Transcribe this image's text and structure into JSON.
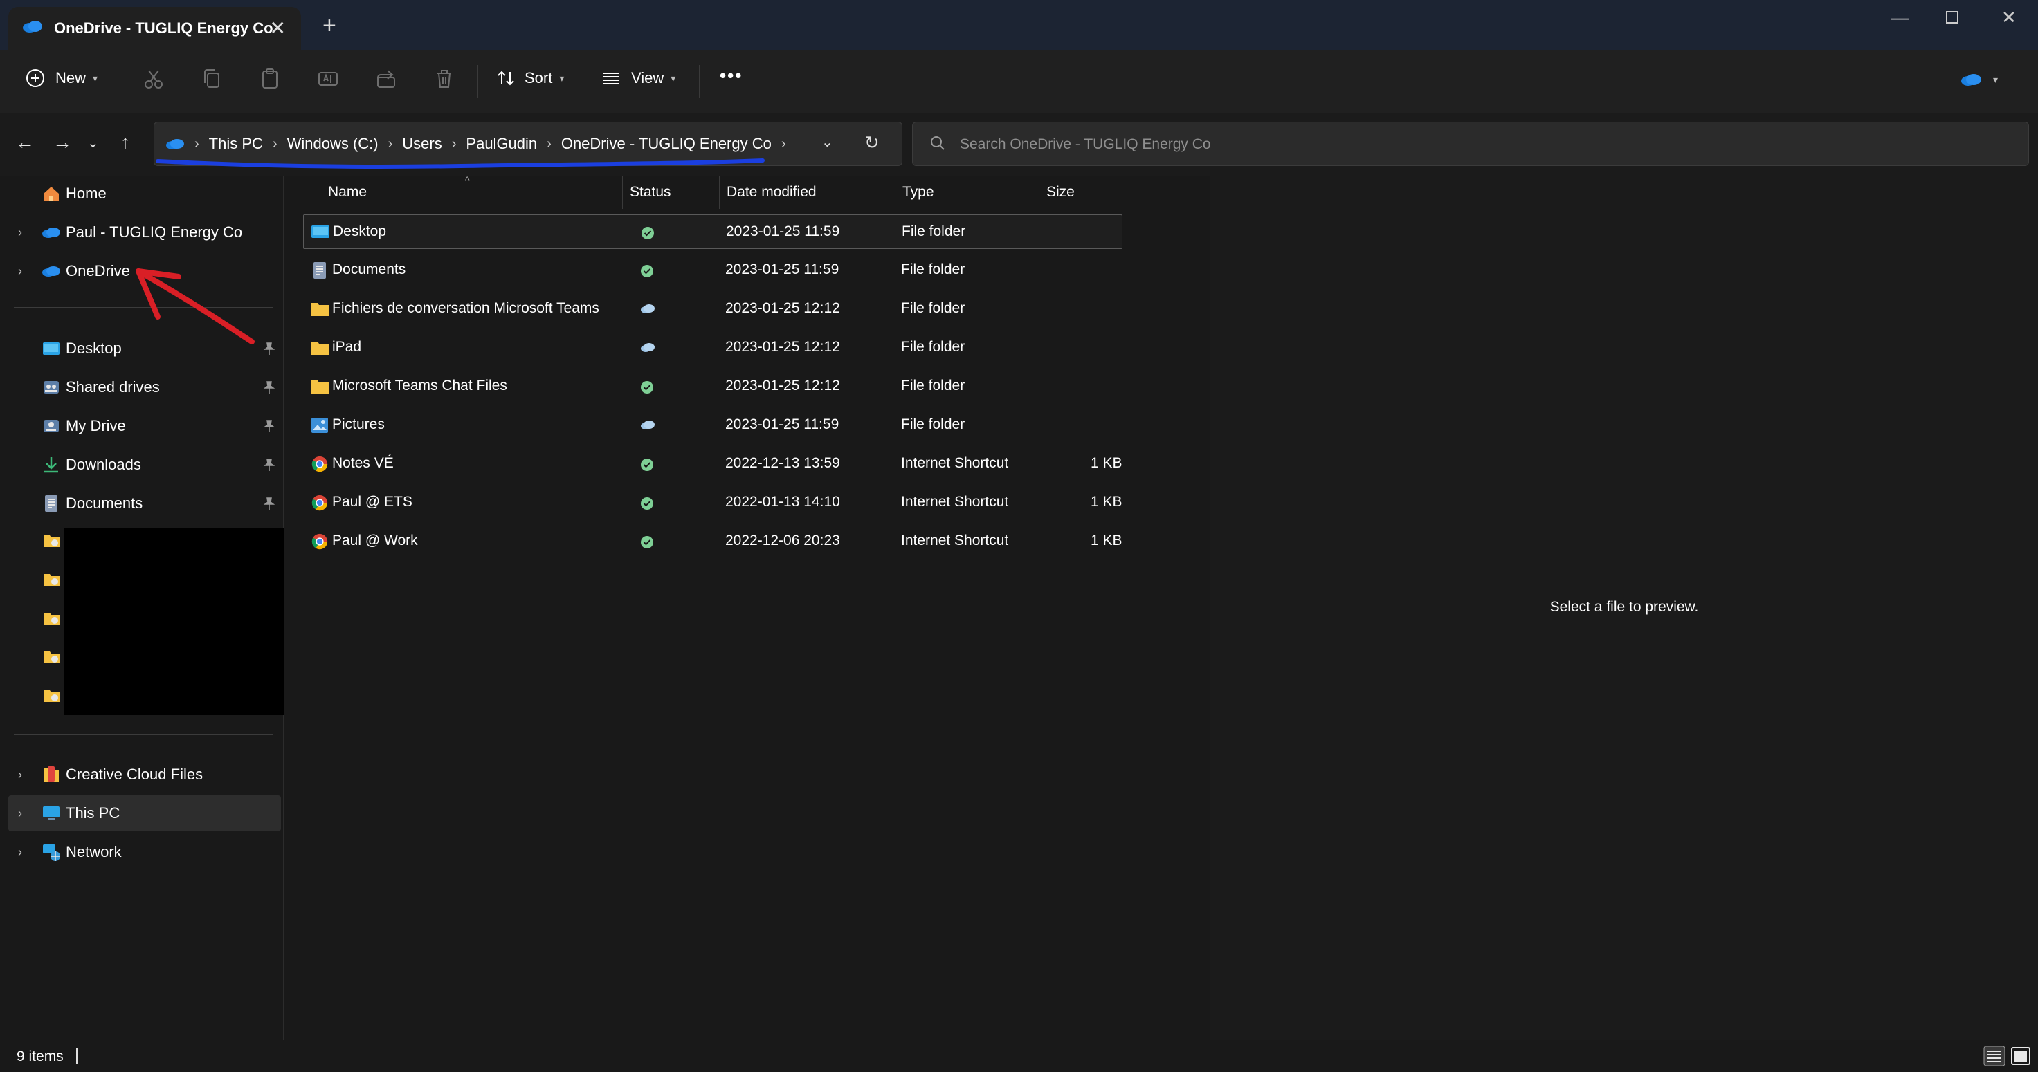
{
  "window": {
    "tab_title": "OneDrive - TUGLIQ Energy Co",
    "new_tab_icon": "plus-icon"
  },
  "toolbar": {
    "new_label": "New",
    "sort_label": "Sort",
    "view_label": "View",
    "more_label": "•••"
  },
  "address": {
    "crumbs": [
      "This PC",
      "Windows (C:)",
      "Users",
      "PaulGudin",
      "OneDrive - TUGLIQ Energy Co"
    ],
    "search_placeholder": "Search OneDrive - TUGLIQ Energy Co"
  },
  "sidebar": {
    "top": [
      {
        "label": "Home",
        "icon": "home-icon"
      },
      {
        "label": "Paul - TUGLIQ Energy Co",
        "icon": "onedrive-cloud-icon"
      },
      {
        "label": "OneDrive",
        "icon": "onedrive-cloud-icon"
      }
    ],
    "pinned": [
      {
        "label": "Desktop",
        "icon": "desktop-icon"
      },
      {
        "label": "Shared drives",
        "icon": "shared-drives-icon"
      },
      {
        "label": "My Drive",
        "icon": "my-drive-icon"
      },
      {
        "label": "Downloads",
        "icon": "download-icon"
      },
      {
        "label": "Documents",
        "icon": "documents-icon"
      }
    ],
    "bottom": [
      {
        "label": "Creative Cloud Files",
        "icon": "creative-cloud-icon"
      },
      {
        "label": "This PC",
        "icon": "computer-icon"
      },
      {
        "label": "Network",
        "icon": "network-icon"
      }
    ]
  },
  "columns": {
    "name": "Name",
    "status": "Status",
    "date": "Date modified",
    "type": "Type",
    "size": "Size"
  },
  "files": [
    {
      "name": "Desktop",
      "status": "synced",
      "date": "2023-01-25 11:59",
      "type": "File folder",
      "size": ""
    },
    {
      "name": "Documents",
      "status": "synced",
      "date": "2023-01-25 11:59",
      "type": "File folder",
      "size": ""
    },
    {
      "name": "Fichiers de conversation Microsoft Teams",
      "status": "cloud",
      "date": "2023-01-25 12:12",
      "type": "File folder",
      "size": ""
    },
    {
      "name": "iPad",
      "status": "cloud",
      "date": "2023-01-25 12:12",
      "type": "File folder",
      "size": ""
    },
    {
      "name": "Microsoft Teams Chat Files",
      "status": "synced",
      "date": "2023-01-25 12:12",
      "type": "File folder",
      "size": ""
    },
    {
      "name": "Pictures",
      "status": "cloud",
      "date": "2023-01-25 11:59",
      "type": "File folder",
      "size": ""
    },
    {
      "name": "Notes VÉ",
      "status": "synced",
      "date": "2022-12-13 13:59",
      "type": "Internet Shortcut",
      "size": "1 KB"
    },
    {
      "name": "Paul @ ETS",
      "status": "synced",
      "date": "2022-01-13 14:10",
      "type": "Internet Shortcut",
      "size": "1 KB"
    },
    {
      "name": "Paul @ Work",
      "status": "synced",
      "date": "2022-12-06 20:23",
      "type": "Internet Shortcut",
      "size": "1 KB"
    }
  ],
  "preview": {
    "message": "Select a file to preview."
  },
  "statusbar": {
    "count": "9 items"
  },
  "colors": {
    "accent": "#1a6fd4",
    "annotation_red": "#d91f26",
    "annotation_blue": "#1b3fe0",
    "synced_green": "#7ecf95"
  }
}
